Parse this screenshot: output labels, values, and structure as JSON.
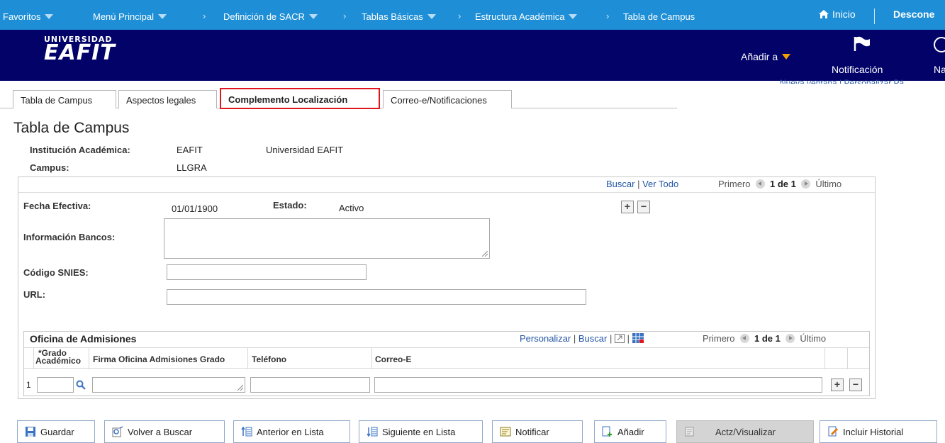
{
  "topnav": {
    "favoritos": "Favoritos",
    "menu_principal": "Menú Principal",
    "crumbs": [
      "Definición de SACR",
      "Tablas Básicas",
      "Estructura Académica",
      "Tabla de Campus"
    ],
    "inicio": "Inicio",
    "desconectar": "Descone"
  },
  "banner": {
    "logo_top": "UNIVERSIDAD",
    "logo_main": "EAFIT",
    "add_to": "Añadir a",
    "notification": "Notificación",
    "nav_partial": "Na"
  },
  "new_window": "Nueva ventana | Personalizar Pá",
  "tabs": [
    "Tabla de Campus",
    "Aspectos legales",
    "Complemento Localización",
    "Correo-e/Notificaciones"
  ],
  "page_title": "Tabla de Campus",
  "header": {
    "institution_label": "Institución Académica:",
    "institution_code": "EAFIT",
    "institution_name": "Universidad EAFIT",
    "campus_label": "Campus:",
    "campus_code": "LLGRA"
  },
  "panel": {
    "buscar": "Buscar",
    "ver_todo": "Ver Todo",
    "primero": "Primero",
    "count": "1 de 1",
    "ultimo": "Último",
    "fecha_label": "Fecha Efectiva:",
    "fecha_value": "01/01/1900",
    "estado_label": "Estado:",
    "estado_value": "Activo",
    "bancos_label": "Información Bancos:",
    "snies_label": "Código SNIES:",
    "url_label": "URL:"
  },
  "grid": {
    "title": "Oficina de Admisiones",
    "personalizar": "Personalizar",
    "buscar": "Buscar",
    "primero": "Primero",
    "count": "1 de 1",
    "ultimo": "Último",
    "col_grado_1": "*Grado",
    "col_grado_2": "Académico",
    "col_firma": "Firma Oficina Admisiones Grado",
    "col_telefono": "Teléfono",
    "col_correo": "Correo-E",
    "row_number": "1"
  },
  "buttons": [
    "Guardar",
    "Volver a Buscar",
    "Anterior en Lista",
    "Siguiente en Lista",
    "Notificar",
    "Añadir",
    "Actz/Visualizar",
    "Incluir Historial"
  ],
  "colors": {
    "topnav": "#1e8fd6",
    "banner": "#020269",
    "active_tab_border": "#e0161e",
    "link": "#2356a5"
  }
}
